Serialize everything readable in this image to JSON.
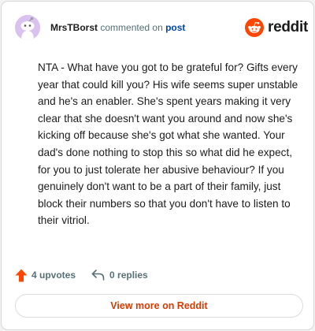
{
  "header": {
    "author": "MrsTBorst",
    "action_text": "commented on",
    "post_link": "post",
    "brand": "reddit"
  },
  "comment": {
    "body": "NTA - What have you got to be grateful for? Gifts every year that could kill you? His wife seems super unstable and he's an enabler. She's spent years making it very clear that she doesn't want you around and now she's kicking off because she's got what she wanted. Your dad's done nothing to stop this so what did he expect, for you to just tolerate her abusive behaviour? If you genuinely don't want to be a part of their family, just block their numbers so that you don't have to listen to their vitriol."
  },
  "actions": {
    "upvotes": "4 upvotes",
    "replies": "0 replies"
  },
  "footer": {
    "view_more": "View more on Reddit"
  },
  "icons": {
    "avatar": "snoo-avatar-icon",
    "logo": "reddit-logo-icon",
    "upvote": "upvote-arrow-icon",
    "reply": "reply-arrow-icon"
  },
  "colors": {
    "brand_orange": "#ff4500",
    "link_blue": "#0045ac",
    "button_text": "#d93a00",
    "avatar_bg": "#d9c2f0"
  }
}
